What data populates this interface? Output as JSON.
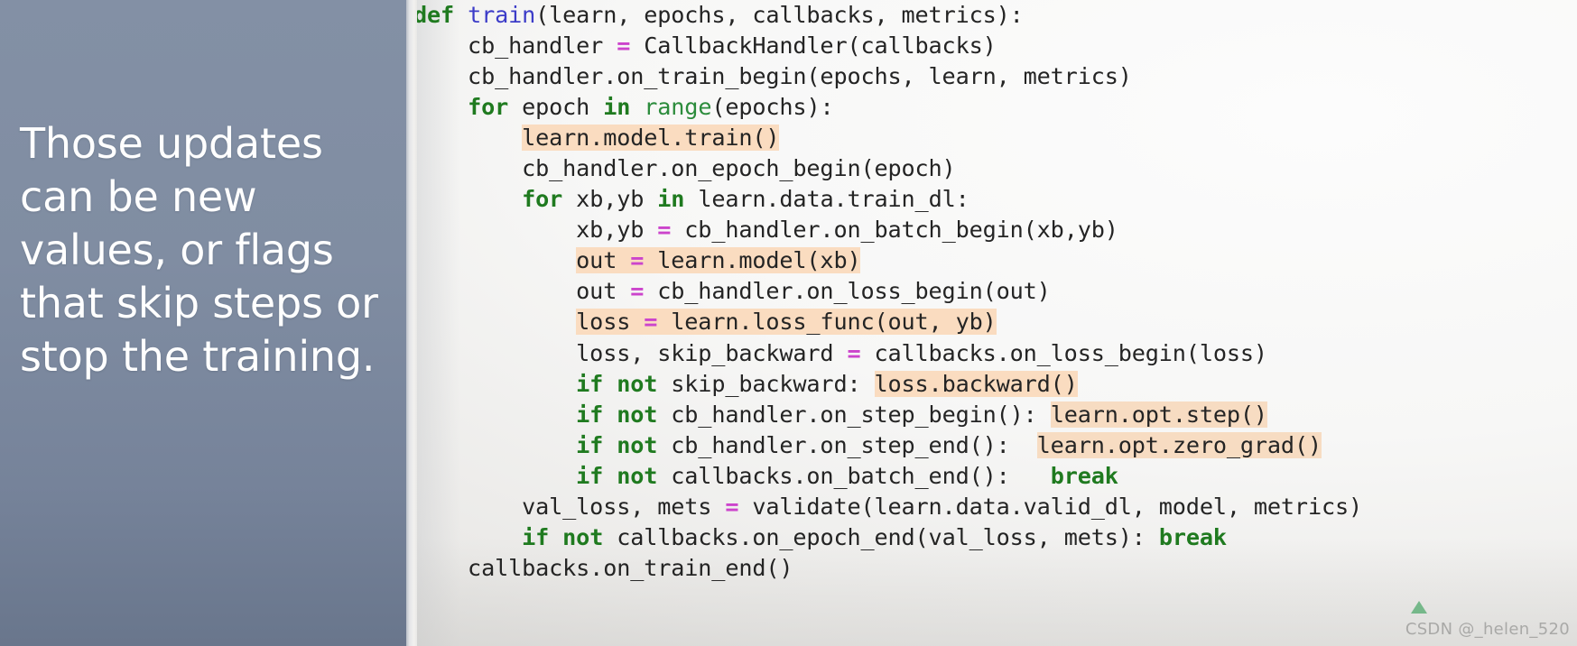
{
  "slide": {
    "left_panel": {
      "text": "Those updates can be new values, or flags that skip steps or stop the training.",
      "background_color": "#808da2",
      "text_color": "#ffffff"
    },
    "code_panel": {
      "language": "python",
      "background_color": "#f7f7f6",
      "default_text_color": "#242424",
      "keyword_color": "#1f7a1f",
      "function_name_color": "#3c3cc8",
      "builtin_color": "#2c8c3c",
      "operator_color": "#cc44cc",
      "highlight_color": "#fadcc0",
      "lines": [
        "def train(learn, epochs, callbacks, metrics):",
        "    cb_handler = CallbackHandler(callbacks)",
        "    cb_handler.on_train_begin(epochs, learn, metrics)",
        "    for epoch in range(epochs):",
        "        learn.model.train()",
        "        cb_handler.on_epoch_begin(epoch)",
        "        for xb,yb in learn.data.train_dl:",
        "            xb,yb = cb_handler.on_batch_begin(xb,yb)",
        "            out = learn.model(xb)",
        "            out = cb_handler.on_loss_begin(out)",
        "            loss = learn.loss_func(out, yb)",
        "            loss, skip_backward = callbacks.on_loss_begin(loss)",
        "            if not skip_backward: loss.backward()",
        "            if not cb_handler.on_step_begin(): learn.opt.step()",
        "            if not cb_handler.on_step_end():  learn.opt.zero_grad()",
        "            if not callbacks.on_batch_end():   break",
        "        val_loss, mets = validate(learn.data.valid_dl, model, metrics)",
        "        if not callbacks.on_epoch_end(val_loss, mets): break",
        "    callbacks.on_train_end()"
      ],
      "highlighted_fragments": [
        "learn.model.train()",
        "out = learn.model(xb)",
        "loss = learn.loss_func(out, yb)",
        "loss.backward()",
        "learn.opt.step()",
        "learn.opt.zero_grad()"
      ]
    }
  },
  "watermark": {
    "text": "CSDN @_helen_520",
    "color": "#a9a9a7",
    "logo_icon": "csdn-logo-icon"
  }
}
